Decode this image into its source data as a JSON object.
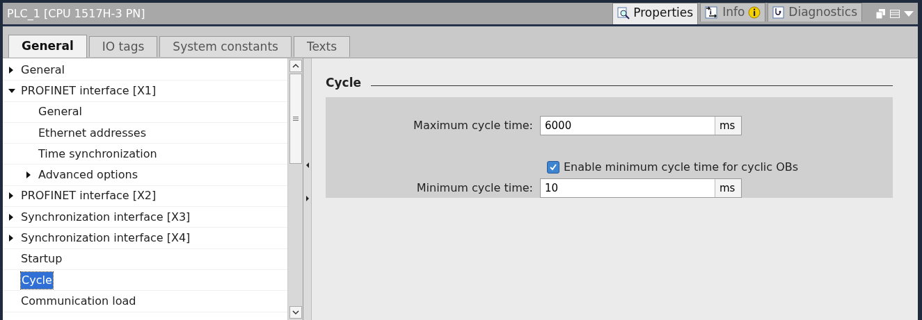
{
  "window": {
    "title": "PLC_1 [CPU 1517H-3 PN]"
  },
  "inspector_tabs": [
    {
      "label": "Properties",
      "selected": true,
      "kind": "properties",
      "badge": false
    },
    {
      "label": "Info",
      "selected": false,
      "kind": "info",
      "badge": true
    },
    {
      "label": "Diagnostics",
      "selected": false,
      "kind": "diagnostics",
      "badge": false
    }
  ],
  "tabs": [
    {
      "label": "General",
      "selected": true
    },
    {
      "label": "IO tags",
      "selected": false
    },
    {
      "label": "System constants",
      "selected": false
    },
    {
      "label": "Texts",
      "selected": false
    }
  ],
  "tree": [
    {
      "label": "General",
      "expanded": false,
      "selected": false
    },
    {
      "label": "PROFINET interface [X1]",
      "expanded": true,
      "selected": false,
      "children": [
        {
          "label": "General",
          "selected": false
        },
        {
          "label": "Ethernet addresses",
          "selected": false
        },
        {
          "label": "Time synchronization",
          "selected": false
        },
        {
          "label": "Advanced options",
          "expanded": false,
          "selected": false
        }
      ]
    },
    {
      "label": "PROFINET interface [X2]",
      "expanded": false,
      "selected": false
    },
    {
      "label": "Synchronization interface [X3]",
      "expanded": false,
      "selected": false
    },
    {
      "label": "Synchronization interface [X4]",
      "expanded": false,
      "selected": false
    },
    {
      "label": "Startup",
      "selected": false
    },
    {
      "label": "Cycle",
      "selected": true
    },
    {
      "label": "Communication load",
      "selected": false
    }
  ],
  "section": {
    "title": "Cycle",
    "max_cycle": {
      "label": "Maximum cycle time:",
      "value": "6000",
      "unit": "ms"
    },
    "enable_min": {
      "label": "Enable minimum cycle time for cyclic OBs",
      "checked": true
    },
    "min_cycle": {
      "label": "Minimum cycle time:",
      "value": "10",
      "unit": "ms"
    }
  }
}
